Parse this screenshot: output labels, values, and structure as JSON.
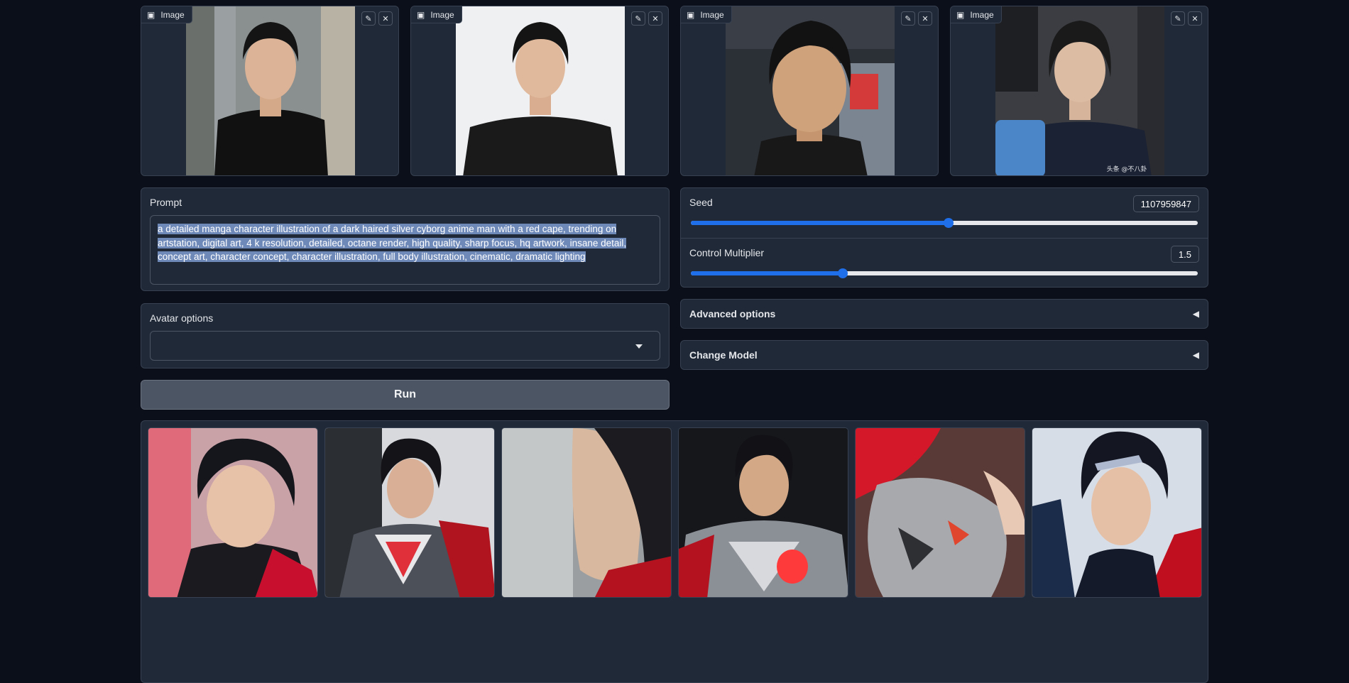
{
  "uploads": [
    {
      "label": "Image"
    },
    {
      "label": "Image"
    },
    {
      "label": "Image"
    },
    {
      "label": "Image"
    }
  ],
  "prompt": {
    "label": "Prompt",
    "value": "a detailed manga character illustration of a dark haired silver cyborg anime man with a red cape, trending on artstation, digital art, 4 k resolution, detailed, octane render, high quality, sharp focus, hq artwork, insane detail, concept art, character concept, character illustration, full body illustration, cinematic, dramatic lighting"
  },
  "avatar_options": {
    "label": "Avatar options",
    "selected": ""
  },
  "run_button": {
    "label": "Run"
  },
  "seed": {
    "label": "Seed",
    "value": "1107959847",
    "fraction": 0.508
  },
  "control_multiplier": {
    "label": "Control Multiplier",
    "value": "1.5",
    "fraction": 0.3
  },
  "advanced_options": {
    "label": "Advanced options",
    "icon": "triangle-left-icon"
  },
  "change_model": {
    "label": "Change Model",
    "icon": "triangle-left-icon"
  },
  "photo_watermark": "头条 @不八卦",
  "colors": {
    "accent": "#1f6feb",
    "background": "#0b0f19",
    "panel": "#1f2937",
    "red": "#c8102e"
  }
}
